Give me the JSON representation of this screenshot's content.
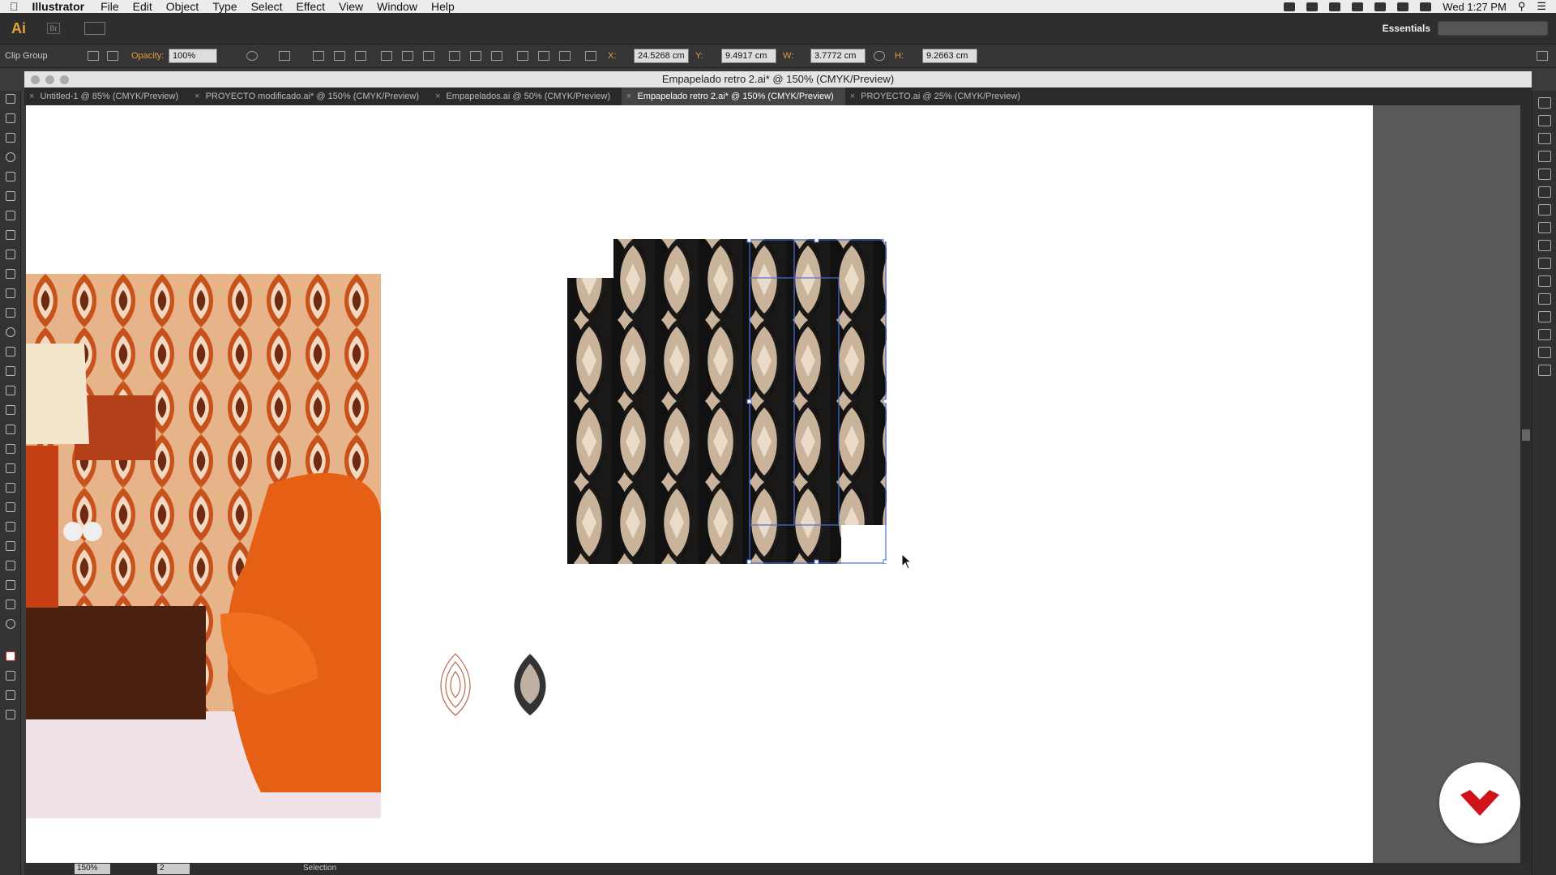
{
  "menubar": {
    "app_name": "Illustrator",
    "menus": [
      "File",
      "Edit",
      "Object",
      "Type",
      "Select",
      "Effect",
      "View",
      "Window",
      "Help"
    ],
    "clock": "Wed 1:27 PM"
  },
  "appbar": {
    "logo": "Ai",
    "bridge": "Br",
    "workspace": "Essentials"
  },
  "controlbar": {
    "selection_type": "Clip Group",
    "opacity_label": "Opacity:",
    "opacity_value": "100%",
    "x_label": "X:",
    "x_value": "24.5268 cm",
    "y_label": "Y:",
    "y_value": "9.4917 cm",
    "w_label": "W:",
    "w_value": "3.7772 cm",
    "h_label": "H:",
    "h_value": "9.2663 cm"
  },
  "document": {
    "window_title": "Empapelado retro 2.ai* @ 150% (CMYK/Preview)",
    "tabs": [
      {
        "label": "Untitled-1 @ 85% (CMYK/Preview)",
        "active": false
      },
      {
        "label": "PROYECTO modificado.ai* @ 150% (CMYK/Preview)",
        "active": false
      },
      {
        "label": "Empapelados.ai @ 50% (CMYK/Preview)",
        "active": false
      },
      {
        "label": "Empapelado retro 2.ai* @ 150% (CMYK/Preview)",
        "active": true
      },
      {
        "label": "PROYECTO.ai @ 25% (CMYK/Preview)",
        "active": false
      }
    ]
  },
  "statusbar": {
    "zoom": "150%",
    "artboard": "2",
    "current_tool": "Selection"
  },
  "colors": {
    "pattern_tan": "#c9b39a",
    "pattern_black": "#111111",
    "wallpaper_orange": "#c8521c",
    "logo_red": "#d0121b",
    "selection_blue": "#4a6fd8"
  }
}
